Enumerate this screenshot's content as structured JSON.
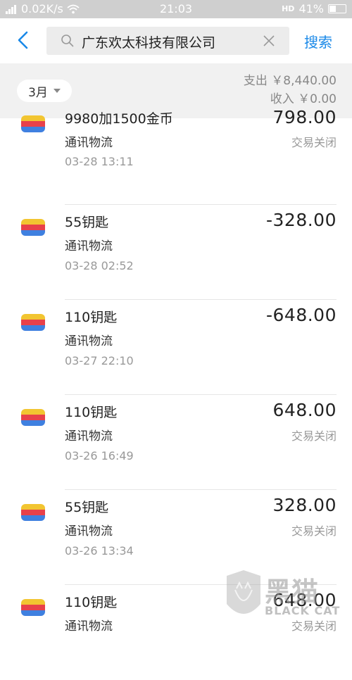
{
  "status_bar": {
    "network_speed": "0.02K/s",
    "time": "21:03",
    "hd_label": "HD",
    "battery": "41%"
  },
  "search": {
    "query": "广东欢太科技有限公司",
    "search_button": "搜索"
  },
  "filter": {
    "month": "3月",
    "expense": "支出 ￥8,440.00",
    "income": "收入 ￥0.00"
  },
  "transactions": [
    {
      "title": "9980加1500金币",
      "category": "通讯物流",
      "time": "03-28  13:11",
      "amount": "798.00",
      "status": "交易关闭"
    },
    {
      "title": "55钥匙",
      "category": "通讯物流",
      "time": "03-28  02:52",
      "amount": "-328.00",
      "status": ""
    },
    {
      "title": "110钥匙",
      "category": "通讯物流",
      "time": "03-27  22:10",
      "amount": "-648.00",
      "status": ""
    },
    {
      "title": "110钥匙",
      "category": "通讯物流",
      "time": "03-26  16:49",
      "amount": "648.00",
      "status": "交易关闭"
    },
    {
      "title": "55钥匙",
      "category": "通讯物流",
      "time": "03-26  13:34",
      "amount": "328.00",
      "status": "交易关闭"
    },
    {
      "title": "110钥匙",
      "category": "通讯物流",
      "time": "",
      "amount": "648.00",
      "status": "交易关闭"
    }
  ],
  "watermark": {
    "main": "黑猫",
    "sub": "BLACK CAT"
  },
  "colors": {
    "accent": "#1a89e8",
    "icon_yellow": "#f2c531",
    "icon_red": "#e8414a",
    "icon_blue": "#3f80e0"
  }
}
